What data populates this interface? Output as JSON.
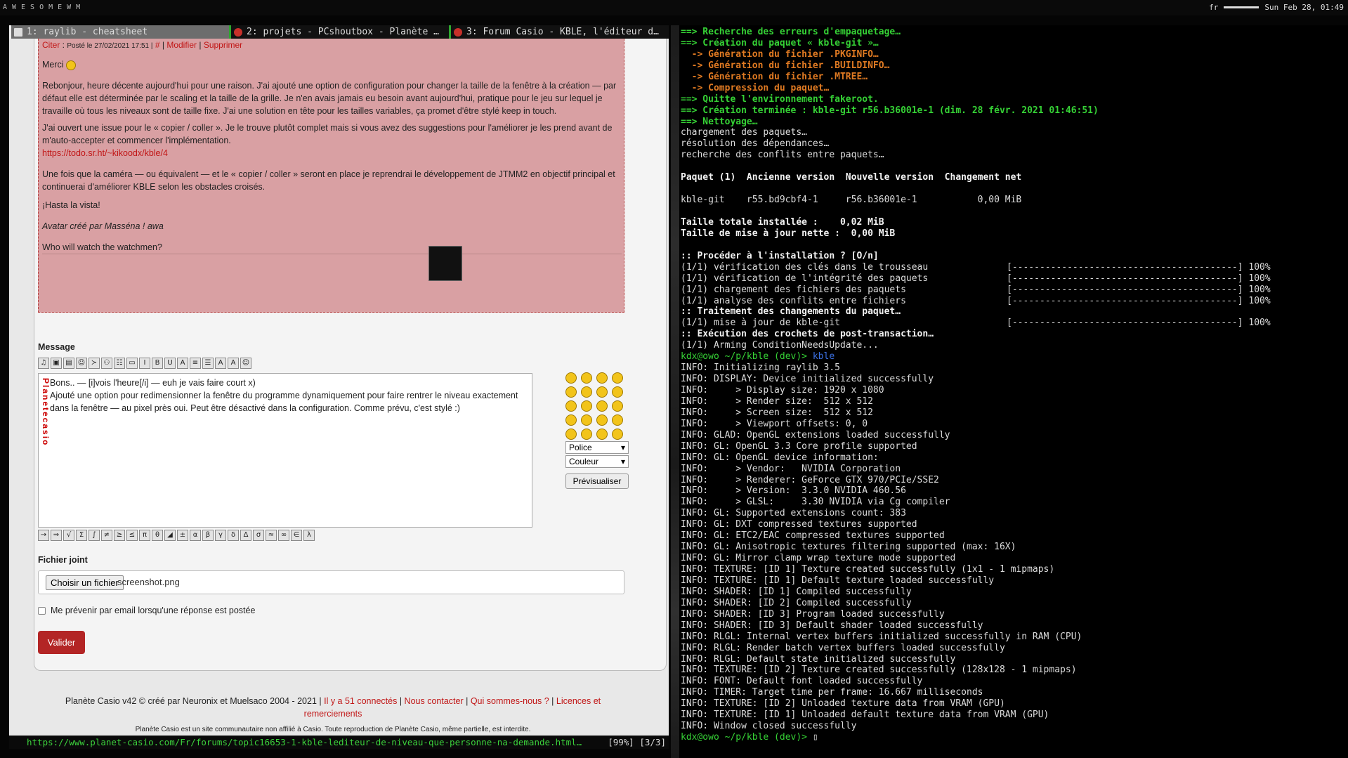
{
  "topbar": {
    "wm_name": "AWESOMEWM",
    "lang": "fr",
    "clock": "Sun Feb 28, 01:49"
  },
  "tabs": [
    {
      "label": "1: raylib - cheatsheet"
    },
    {
      "label": "2: projets - PCshoutbox - Planète …"
    },
    {
      "label": "3: Forum Casio - KBLE, l'éditeur d…"
    }
  ],
  "post": {
    "cite": "Citer",
    "posted": "Posté le 27/02/2021 17:51 |",
    "hash": "#",
    "modify": "Modifier",
    "delete": "Supprimer",
    "merci": "Merci",
    "para1": "Rebonjour, heure décente aujourd'hui pour une raison. J'ai ajouté une option de configuration pour changer la taille de la fenêtre à la création — par défaut elle est déterminée par le scaling et la taille de la grille. Je n'en avais jamais eu besoin avant aujourd'hui, pratique pour le jeu sur lequel je travaille où tous les niveaux sont de taille fixe. J'ai une solution en tête pour les tailles variables, ça promet d'être stylé keep in touch.",
    "para2": "J'ai ouvert une issue pour le « copier / coller ». Je le trouve plutôt complet mais si vous avez des suggestions pour l'améliorer je les prend avant de m'auto-accepter et commencer l'implémentation.",
    "link": "https://todo.sr.ht/~kikoodx/kble/4",
    "para3": "Une fois que la caméra — ou équivalent — et le « copier / coller » seront en place je reprendrai le développement de JTMM2 en objectif principal et continuerai d'améliorer KBLE selon les obstacles croisés.",
    "bye": "¡Hasta la vista!",
    "sig1": "Avatar créé par Masséna ! awa",
    "sig2": "Who will watch the watchmen?"
  },
  "form": {
    "message_label": "Message",
    "text_line1": "Bons.. — [i]vois l'heure[/i] — euh je vais faire court x)",
    "text_line2": "Ajouté une option pour redimensionner la fenêtre du programme dynamiquement pour faire rentrer le niveau exactement dans la fenêtre — au pixel près oui. Peut être désactivé dans la configuration. Comme prévu, c'est stylé :)",
    "watermark": "Planetecasio",
    "font_select": "Police",
    "color_select": "Couleur",
    "preview": "Prévisualiser",
    "toolbar1": [
      "♫",
      "▣",
      "▤",
      "☺",
      "≻",
      "⚇",
      "☷",
      "▭",
      "I",
      "B",
      "U",
      "A",
      "≡",
      "☰",
      "A",
      "A",
      "☺"
    ],
    "toolbar2": [
      "→",
      "⇒",
      "√",
      "Σ",
      "∫",
      "≠",
      "≥",
      "≤",
      "π",
      "θ",
      "◢",
      "±",
      "α",
      "β",
      "γ",
      "δ",
      "Δ",
      "σ",
      "≈",
      "∞",
      "∈",
      "λ"
    ],
    "file_label": "Fichier joint",
    "file_button": "Choisir un fichier",
    "file_name": "screenshot.png",
    "notify": "Me prévenir par email lorsqu'une réponse est postée",
    "submit": "Valider"
  },
  "footer": {
    "credits": "Planète Casio v42 © créé par Neuronix et Muelsaco 2004 - 2021 |",
    "connected": "Il y a 51 connectés",
    "contact": "Nous contacter",
    "about": "Qui sommes-nous ?",
    "licenses": "Licences et remerciements",
    "disclaimer": "Planète Casio est un site communautaire non affilié à Casio. Toute reproduction de Planète Casio, même partielle, est interdite."
  },
  "statusbar": {
    "url": "https://www.planet-casio.com/Fr/forums/topic16653-1-kble-lediteur-de-niveau-que-personne-na-demande.html…",
    "pos": "[99%] [3/3]"
  },
  "terminal": {
    "lines": [
      {
        "t": "==> Recherche des erreurs d'empaquetage…",
        "c": "green"
      },
      {
        "t": "==> Création du paquet « kble-git »…",
        "c": "green"
      },
      {
        "t": "  -> Génération du fichier .PKGINFO…",
        "c": "orange"
      },
      {
        "t": "  -> Génération du fichier .BUILDINFO…",
        "c": "orange"
      },
      {
        "t": "  -> Génération du fichier .MTREE…",
        "c": "orange"
      },
      {
        "t": "  -> Compression du paquet…",
        "c": "orange"
      },
      {
        "t": "==> Quitte l'environnement fakeroot.",
        "c": "green"
      },
      {
        "t": "==> Création terminée : kble-git r56.b36001e-1 (dim. 28 févr. 2021 01:46:51)",
        "c": "green"
      },
      {
        "t": "==> Nettoyage…",
        "c": "green"
      },
      {
        "t": "chargement des paquets…",
        "c": ""
      },
      {
        "t": "résolution des dépendances…",
        "c": ""
      },
      {
        "t": "recherche des conflits entre paquets…",
        "c": ""
      },
      {
        "t": "",
        "c": ""
      },
      {
        "t": "Paquet (1)  Ancienne version  Nouvelle version  Changement net",
        "c": "bold"
      },
      {
        "t": "",
        "c": ""
      },
      {
        "t": "kble-git    r55.bd9cbf4-1     r56.b36001e-1           0,00 MiB",
        "c": ""
      },
      {
        "t": "",
        "c": ""
      },
      {
        "t": "Taille totale installée :    0,02 MiB",
        "c": "bold"
      },
      {
        "t": "Taille de mise à jour nette :  0,00 MiB",
        "c": "bold"
      },
      {
        "t": "",
        "c": ""
      },
      {
        "t": ":: Procéder à l'installation ? [O/n]",
        "c": "bold"
      },
      {
        "t": "(1/1) vérification des clés dans le trousseau",
        "c": "",
        "p": "[-----------------------------------------] 100%"
      },
      {
        "t": "(1/1) vérification de l'intégrité des paquets",
        "c": "",
        "p": "[-----------------------------------------] 100%"
      },
      {
        "t": "(1/1) chargement des fichiers des paquets",
        "c": "",
        "p": "[-----------------------------------------] 100%"
      },
      {
        "t": "(1/1) analyse des conflits entre fichiers",
        "c": "",
        "p": "[-----------------------------------------] 100%"
      },
      {
        "t": ":: Traitement des changements du paquet…",
        "c": "bold"
      },
      {
        "t": "(1/1) mise à jour de kble-git",
        "c": "",
        "p": "[-----------------------------------------] 100%"
      },
      {
        "t": ":: Exécution des crochets de post-transaction…",
        "c": "bold"
      },
      {
        "t": "(1/1) Arming ConditionNeedsUpdate...",
        "c": ""
      },
      {
        "t": "kdx@owo ~/p/kble (dev)> ",
        "c": "prompt",
        "cmd": "kble"
      },
      {
        "t": "INFO: Initializing raylib 3.5",
        "c": ""
      },
      {
        "t": "INFO: DISPLAY: Device initialized successfully",
        "c": ""
      },
      {
        "t": "INFO:     > Display size: 1920 x 1080",
        "c": ""
      },
      {
        "t": "INFO:     > Render size:  512 x 512",
        "c": ""
      },
      {
        "t": "INFO:     > Screen size:  512 x 512",
        "c": ""
      },
      {
        "t": "INFO:     > Viewport offsets: 0, 0",
        "c": ""
      },
      {
        "t": "INFO: GLAD: OpenGL extensions loaded successfully",
        "c": ""
      },
      {
        "t": "INFO: GL: OpenGL 3.3 Core profile supported",
        "c": ""
      },
      {
        "t": "INFO: GL: OpenGL device information:",
        "c": ""
      },
      {
        "t": "INFO:     > Vendor:   NVIDIA Corporation",
        "c": ""
      },
      {
        "t": "INFO:     > Renderer: GeForce GTX 970/PCIe/SSE2",
        "c": ""
      },
      {
        "t": "INFO:     > Version:  3.3.0 NVIDIA 460.56",
        "c": ""
      },
      {
        "t": "INFO:     > GLSL:     3.30 NVIDIA via Cg compiler",
        "c": ""
      },
      {
        "t": "INFO: GL: Supported extensions count: 383",
        "c": ""
      },
      {
        "t": "INFO: GL: DXT compressed textures supported",
        "c": ""
      },
      {
        "t": "INFO: GL: ETC2/EAC compressed textures supported",
        "c": ""
      },
      {
        "t": "INFO: GL: Anisotropic textures filtering supported (max: 16X)",
        "c": ""
      },
      {
        "t": "INFO: GL: Mirror clamp wrap texture mode supported",
        "c": ""
      },
      {
        "t": "INFO: TEXTURE: [ID 1] Texture created successfully (1x1 - 1 mipmaps)",
        "c": ""
      },
      {
        "t": "INFO: TEXTURE: [ID 1] Default texture loaded successfully",
        "c": ""
      },
      {
        "t": "INFO: SHADER: [ID 1] Compiled successfully",
        "c": ""
      },
      {
        "t": "INFO: SHADER: [ID 2] Compiled successfully",
        "c": ""
      },
      {
        "t": "INFO: SHADER: [ID 3] Program loaded successfully",
        "c": ""
      },
      {
        "t": "INFO: SHADER: [ID 3] Default shader loaded successfully",
        "c": ""
      },
      {
        "t": "INFO: RLGL: Internal vertex buffers initialized successfully in RAM (CPU)",
        "c": ""
      },
      {
        "t": "INFO: RLGL: Render batch vertex buffers loaded successfully",
        "c": ""
      },
      {
        "t": "INFO: RLGL: Default state initialized successfully",
        "c": ""
      },
      {
        "t": "INFO: TEXTURE: [ID 2] Texture created successfully (128x128 - 1 mipmaps)",
        "c": ""
      },
      {
        "t": "INFO: FONT: Default font loaded successfully",
        "c": ""
      },
      {
        "t": "INFO: TIMER: Target time per frame: 16.667 milliseconds",
        "c": ""
      },
      {
        "t": "INFO: TEXTURE: [ID 2] Unloaded texture data from VRAM (GPU)",
        "c": ""
      },
      {
        "t": "INFO: TEXTURE: [ID 1] Unloaded default texture data from VRAM (GPU)",
        "c": ""
      },
      {
        "t": "INFO: Window closed successfully",
        "c": ""
      },
      {
        "t": "kdx@owo ~/p/kble (dev)> ",
        "c": "prompt",
        "cursor": "▯"
      }
    ]
  }
}
